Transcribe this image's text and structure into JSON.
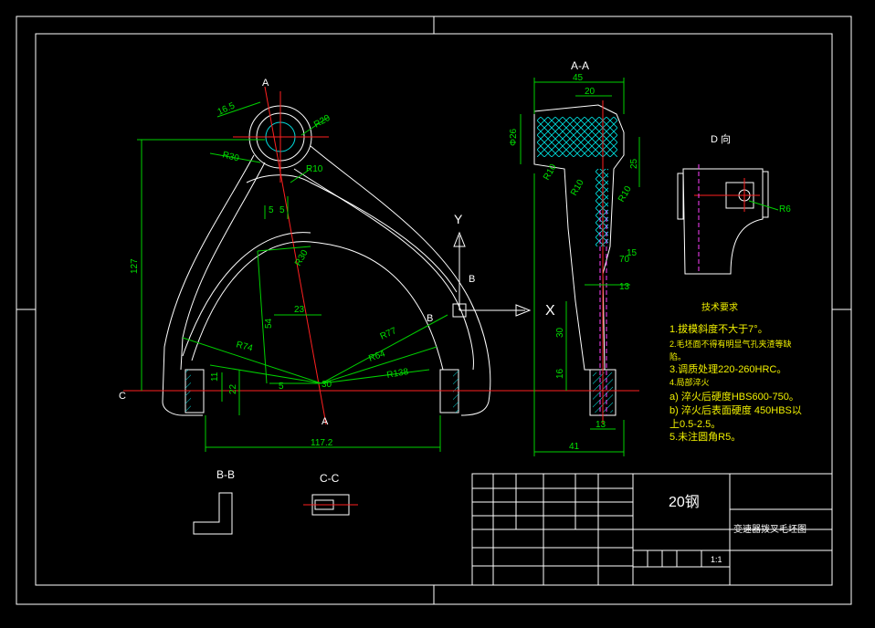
{
  "title_block": {
    "material": "20钢",
    "part_name": "变速器拨叉毛坯图",
    "scale": "1:1"
  },
  "views": {
    "section_aa": "A-A",
    "section_bb": "B-B",
    "section_cc": "C-C",
    "view_d": "D 向",
    "cut_a": "A",
    "cut_b": "B",
    "cut_c": "C",
    "axis_x": "X",
    "axis_y": "Y"
  },
  "tech_requirements": {
    "heading": "技术要求",
    "lines": [
      "1.拔模斜度不大于7°。",
      "2.毛坯面不得有明显气孔夹渣等缺",
      "陷。",
      "3.调质处理220-260HRC。",
      "4.局部淬火",
      "a) 淬火后硬度HBS600-750。",
      "b) 淬火后表面硬度 450HBS以",
      "上0.5-2.5。",
      "5.未注圆角R5。"
    ]
  },
  "dimensions": {
    "front": {
      "d_16_5": "16.5",
      "r20": "R20",
      "r30": "R30",
      "r10": "R10",
      "five_a": "5",
      "five_b": "5",
      "r30b": "R30",
      "d_127": "127",
      "d_54": "54",
      "d_23": "23",
      "r77": "R77",
      "r74": "R74",
      "r64": "R64",
      "r138": "R138",
      "d_11": "11",
      "d_22": "22",
      "d_5": "5",
      "d_30": "30",
      "d_117_2": "117.2"
    },
    "side": {
      "d_45": "45",
      "d_20": "20",
      "phi26": "Φ26",
      "d_25": "25",
      "r10": "R10",
      "r10b": "R10",
      "r10c": "R10",
      "d_15": "15",
      "d_70": "70",
      "d_13": "13",
      "d_30": "30",
      "d_16": "16",
      "d_13b": "13",
      "d_41": "41"
    },
    "view_d": {
      "r6": "R6"
    }
  },
  "colors": {
    "background": "#000000",
    "outline": "#ffffff",
    "dimension": "#00d000",
    "center_line": "#ff2020",
    "hatch": "#00e0e0",
    "hidden": "#ff40ff",
    "note_text": "#f0f000"
  }
}
